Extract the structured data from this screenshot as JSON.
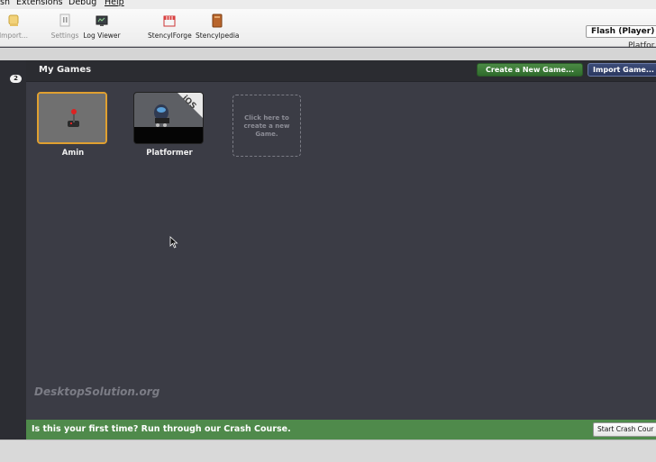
{
  "menu": {
    "items": [
      "sh",
      "Extensions",
      "Debug",
      "Help"
    ]
  },
  "toolbar": {
    "tools": [
      {
        "label": "Import...",
        "icon": "import-icon"
      },
      {
        "label": "Settings",
        "icon": "settings-icon"
      },
      {
        "label": "Log Viewer",
        "icon": "log-viewer-icon"
      },
      {
        "label": "StencylForge",
        "icon": "stencylforge-icon"
      },
      {
        "label": "Stencylpedia",
        "icon": "stencylpedia-icon"
      }
    ],
    "target_select": "Flash (Player)",
    "platform_label": "Platfor"
  },
  "sidebar": {
    "badge": "2"
  },
  "header": {
    "title": "My Games",
    "create_button": "Create a New Game...",
    "import_button": "Import Game..."
  },
  "games": [
    {
      "name": "Amin",
      "selected": true
    },
    {
      "name": "Platformer",
      "ribbon": "iOS"
    }
  ],
  "new_game_placeholder": "Click here to create a new Game.",
  "watermark": "DesktopSolution.org",
  "crash_course": {
    "text": "Is this your first time? Run through our Crash Course.",
    "button": "Start Crash Cour"
  },
  "colors": {
    "background": "#3b3c45",
    "header": "#2b2c31",
    "accent_green": "#4f8a4b",
    "selection": "#e0a030",
    "import_blue": "#2b3860"
  }
}
